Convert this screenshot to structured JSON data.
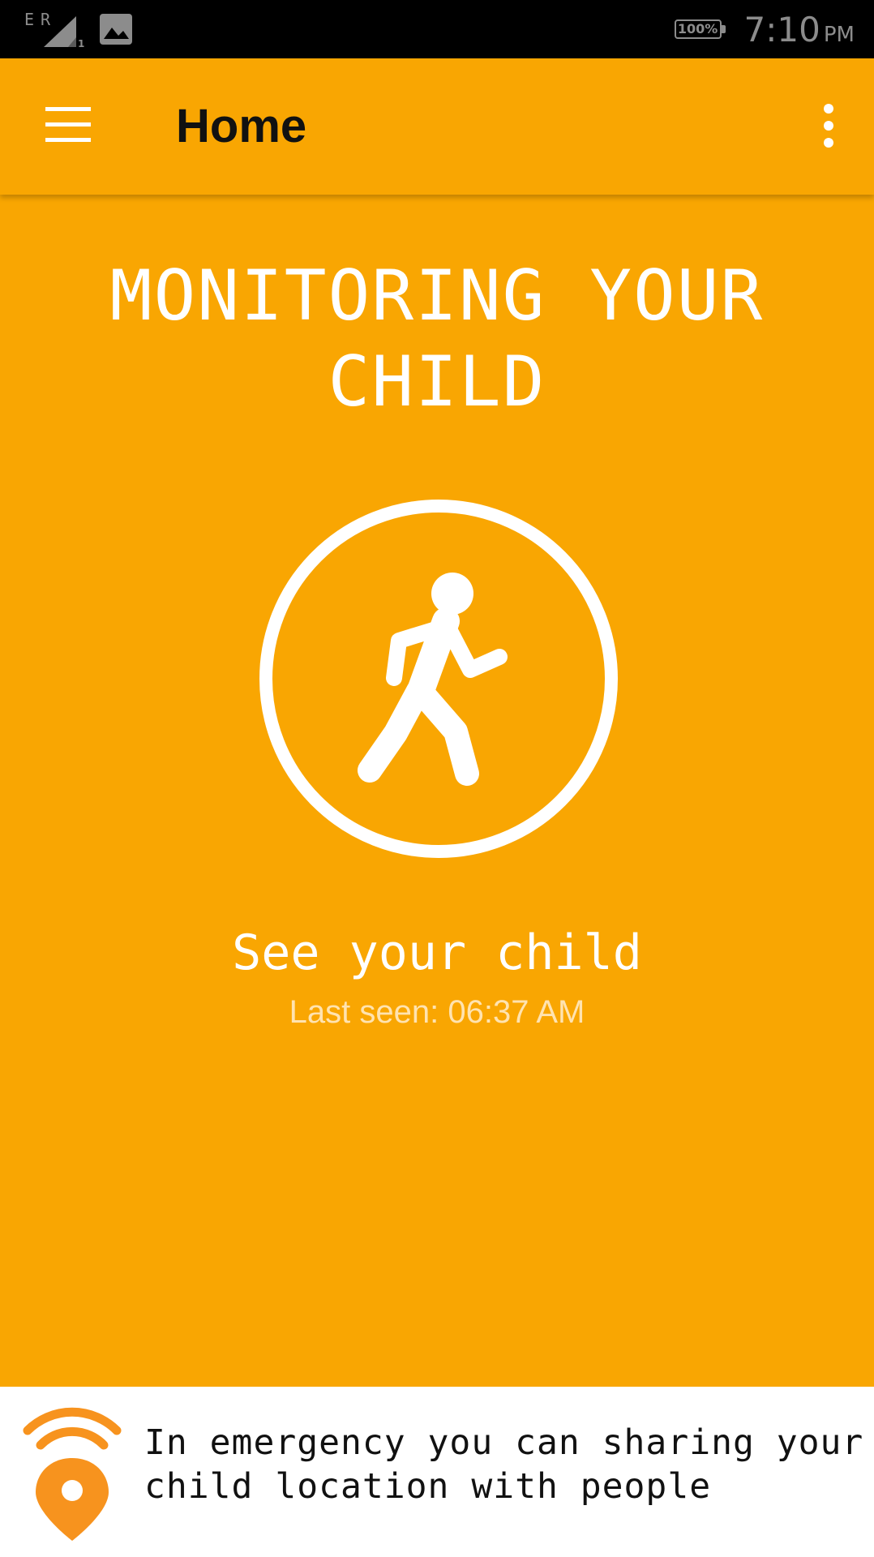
{
  "status_bar": {
    "carrier_label": "ER",
    "sim_slot": "1",
    "battery": "100%",
    "time": "7:10",
    "ampm": "PM",
    "icons": [
      "signal-icon",
      "gallery-icon",
      "battery-icon"
    ]
  },
  "app_bar": {
    "title": "Home",
    "icons": [
      "menu-icon",
      "overflow-menu-icon"
    ]
  },
  "main": {
    "headline": [
      "MONITORING YOUR",
      "CHILD"
    ],
    "action_icon": "walking-person-icon",
    "action_label": "See your child",
    "last_seen": "Last seen: 06:37 AM"
  },
  "banner": {
    "icon": "location-broadcast-icon",
    "text_line1": "In emergency you can sharing your",
    "text_line2": "child location with people"
  },
  "colors": {
    "primary": "#F9A602",
    "pin": "#F7931E",
    "text_dark": "#111111"
  }
}
